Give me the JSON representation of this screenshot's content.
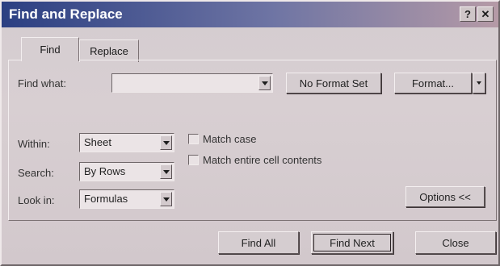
{
  "window": {
    "title": "Find and Replace"
  },
  "titlebar": {
    "help_glyph": "?",
    "close_glyph": "✕"
  },
  "tabs": [
    {
      "label": "Find",
      "active": true
    },
    {
      "label": "Replace",
      "active": false
    }
  ],
  "find": {
    "find_what_label": "Find what:",
    "find_what_value": "",
    "format_status": "No Format Set",
    "format_button": "Format...",
    "within_label": "Within:",
    "within_value": "Sheet",
    "search_label": "Search:",
    "search_value": "By Rows",
    "look_in_label": "Look in:",
    "look_in_value": "Formulas",
    "match_case_label": "Match case",
    "match_case_checked": false,
    "match_entire_label": "Match entire cell contents",
    "match_entire_checked": false,
    "options_button": "Options <<"
  },
  "footer": {
    "find_all": "Find All",
    "find_next": "Find Next",
    "close": "Close"
  },
  "colors": {
    "title_bar_start": "#2b3f82",
    "title_bar_end": "#b59aa6",
    "dialog_face": "#d4ccd0"
  }
}
